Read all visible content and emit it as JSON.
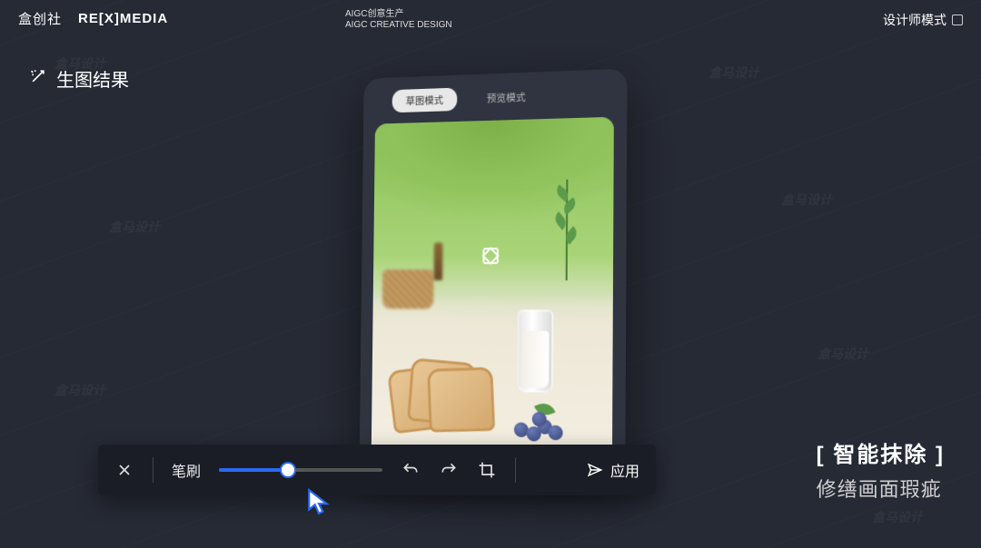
{
  "header": {
    "brand_cn": "盒创社",
    "brand_en": "RE[X]MEDIA",
    "center_line1": "AIGC创意生产",
    "center_line2": "AIGC CREATIVE DESIGN",
    "mode_label": "设计师模式"
  },
  "result_tag": {
    "icon": "magic-wand-icon",
    "label": "生图结果"
  },
  "canvas": {
    "tabs": {
      "sketch": "草图模式",
      "preview": "预览模式",
      "active": "sketch"
    }
  },
  "toolbar": {
    "close_icon": "close-icon",
    "brush_label": "笔刷",
    "slider_value": 42,
    "slider_min": 0,
    "slider_max": 100,
    "undo_icon": "undo-icon",
    "redo_icon": "redo-icon",
    "crop_icon": "crop-icon",
    "apply_icon": "send-icon",
    "apply_label": "应用"
  },
  "caption": {
    "title": "[ 智能抹除 ]",
    "subtitle": "修缮画面瑕疵"
  },
  "watermark_text": "盒马设计"
}
